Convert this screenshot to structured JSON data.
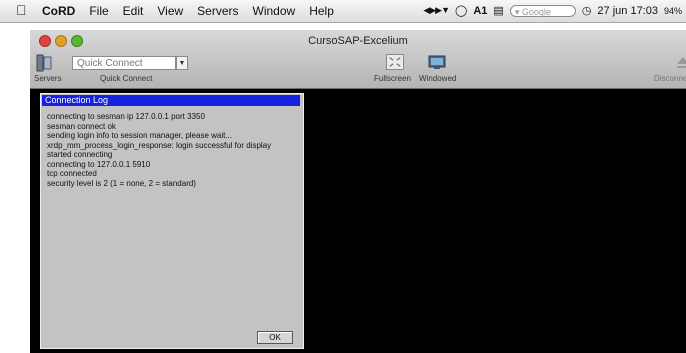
{
  "menubar": {
    "apple_icon": "apple-icon",
    "app_name": "CoRD",
    "items": [
      "File",
      "Edit",
      "View",
      "Servers",
      "Window",
      "Help"
    ],
    "status": {
      "adobe_label": "1",
      "search_placeholder": "Google",
      "clock": "27 jun 17:03",
      "battery": "94%"
    }
  },
  "window": {
    "title": "CursoSAP-Excelium",
    "toolbar": {
      "servers_label": "Servers",
      "quick_connect_value": "Quick Connect",
      "quick_connect_label": "Quick Connect",
      "fullscreen_label": "Fullscreen",
      "windowed_label": "Windowed",
      "disconnect_label": "Disconnect"
    }
  },
  "dialog": {
    "title": "Connection Log",
    "lines": [
      "connecting to sesman ip 127.0.0.1 port 3350",
      "sesman connect ok",
      "sending login info to session manager, please wait...",
      "xrdp_mm_process_login_response: login successful for display",
      "started connecting",
      "connecting to 127.0.0.1 5910",
      "tcp connected",
      "security level is 2 (1 = none, 2 = standard)"
    ],
    "ok_label": "OK"
  },
  "colors": {
    "dialog_title_bg": "#1722e0",
    "dialog_bg": "#c3c3c3",
    "remote_bg": "#000000"
  }
}
